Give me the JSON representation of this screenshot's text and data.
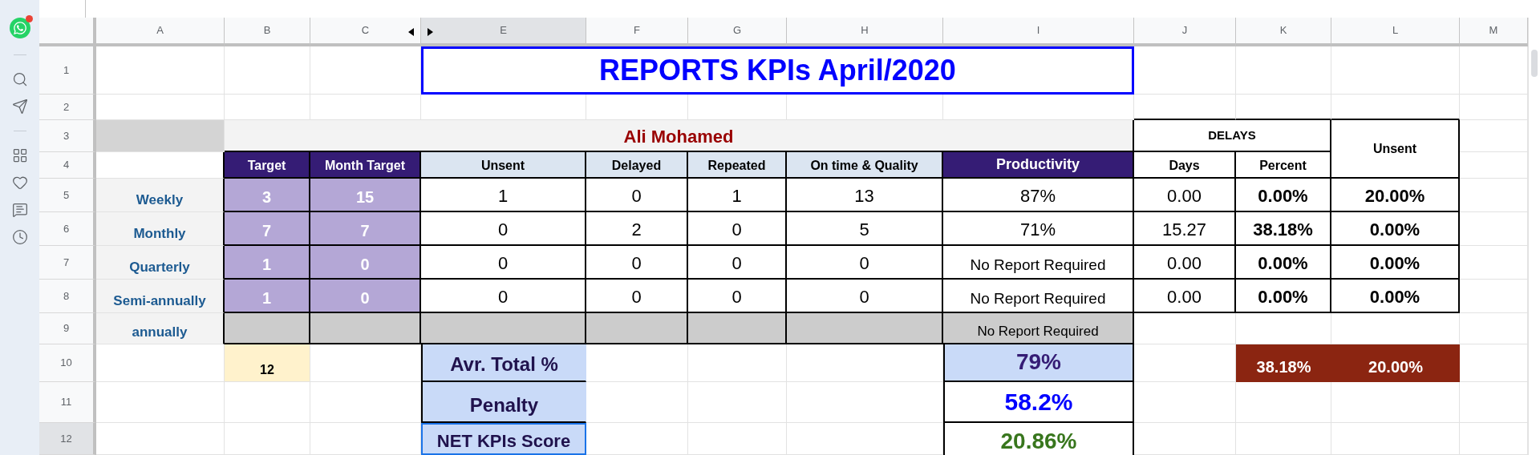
{
  "sidebar": {
    "notification": true
  },
  "columns": [
    {
      "label": "A",
      "selected": false
    },
    {
      "label": "B",
      "selected": false
    },
    {
      "label": "C",
      "selected": false
    },
    {
      "label": "E",
      "selected": true
    },
    {
      "label": "F",
      "selected": false
    },
    {
      "label": "G",
      "selected": false
    },
    {
      "label": "H",
      "selected": false
    },
    {
      "label": "I",
      "selected": false
    },
    {
      "label": "J",
      "selected": false
    },
    {
      "label": "K",
      "selected": false
    },
    {
      "label": "L",
      "selected": false
    },
    {
      "label": "M",
      "selected": false
    }
  ],
  "row_numbers": [
    {
      "label": "1",
      "selected": false
    },
    {
      "label": "2",
      "selected": false
    },
    {
      "label": "3",
      "selected": false
    },
    {
      "label": "4",
      "selected": false
    },
    {
      "label": "5",
      "selected": false
    },
    {
      "label": "6",
      "selected": false
    },
    {
      "label": "7",
      "selected": false
    },
    {
      "label": "8",
      "selected": false
    },
    {
      "label": "9",
      "selected": false
    },
    {
      "label": "10",
      "selected": false
    },
    {
      "label": "11",
      "selected": false
    },
    {
      "label": "12",
      "selected": true
    }
  ],
  "title": "REPORTS KPIs April/2020",
  "employee": "Ali Mohamed",
  "headers": {
    "target": "Target",
    "month_target": "Month Target",
    "unsent": "Unsent",
    "delayed": "Delayed",
    "repeated": "Repeated",
    "on_time": "On time & Quality",
    "productivity": "Productivity",
    "delays": "DELAYS",
    "days": "Days",
    "percent": "Percent",
    "unsent_pct": "Unsent"
  },
  "rows": [
    {
      "kind": "data",
      "label": "Weekly",
      "target": "3",
      "month_target": "15",
      "unsent": "1",
      "delayed": "0",
      "repeated": "1",
      "on_time": "13",
      "productivity": "87%",
      "days": "0.00",
      "percent": "0.00%",
      "unsent_pct": "20.00%"
    },
    {
      "kind": "data",
      "label": "Monthly",
      "target": "7",
      "month_target": "7",
      "unsent": "0",
      "delayed": "2",
      "repeated": "0",
      "on_time": "5",
      "productivity": "71%",
      "days": "15.27",
      "percent": "38.18%",
      "unsent_pct": "0.00%"
    },
    {
      "kind": "data",
      "label": "Quarterly",
      "target": "1",
      "month_target": "0",
      "unsent": "0",
      "delayed": "0",
      "repeated": "0",
      "on_time": "0",
      "productivity": "No Report Required",
      "days": "0.00",
      "percent": "0.00%",
      "unsent_pct": "0.00%"
    },
    {
      "kind": "data",
      "label": "Semi-annually",
      "target": "1",
      "month_target": "0",
      "unsent": "0",
      "delayed": "0",
      "repeated": "0",
      "on_time": "0",
      "productivity": "No Report Required",
      "days": "0.00",
      "percent": "0.00%",
      "unsent_pct": "0.00%"
    },
    {
      "kind": "blank",
      "label": "annually",
      "productivity": "No Report Required"
    }
  ],
  "total_target": "12",
  "avr_total": {
    "label": "Avr. Total %",
    "value": "79%"
  },
  "penalty": {
    "label": "Penalty",
    "value": "58.2%"
  },
  "net_score": {
    "label": "NET KPIs Score",
    "value": "20.86%"
  },
  "delay_totals": {
    "percent": "38.18%",
    "unsent_pct": "20.00%"
  }
}
